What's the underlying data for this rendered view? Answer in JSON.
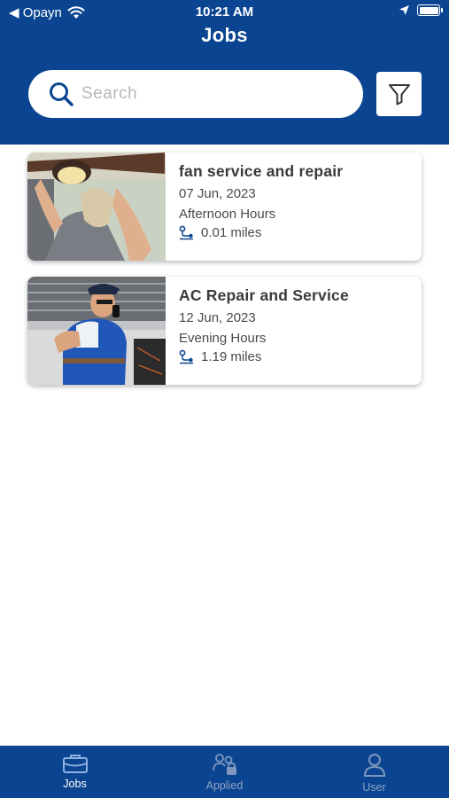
{
  "status_bar": {
    "back_label": "◀ Opayn",
    "time": "10:21 AM"
  },
  "header": {
    "title": "Jobs"
  },
  "search": {
    "placeholder": "Search"
  },
  "jobs": [
    {
      "title": "fan service and repair",
      "date": "07 Jun, 2023",
      "time_slot": "Afternoon Hours",
      "distance": "0.01 miles"
    },
    {
      "title": "AC Repair and Service",
      "date": "12 Jun, 2023",
      "time_slot": "Evening Hours",
      "distance": "1.19 miles"
    }
  ],
  "tabbar": {
    "items": [
      {
        "label": "Jobs",
        "icon": "briefcase-icon",
        "active": true
      },
      {
        "label": "Applied",
        "icon": "people-lock-icon",
        "active": false
      },
      {
        "label": "User",
        "icon": "user-icon",
        "active": false
      }
    ]
  },
  "colors": {
    "brand_blue": "#0b4592",
    "inactive_tab": "#8fa3c4"
  }
}
